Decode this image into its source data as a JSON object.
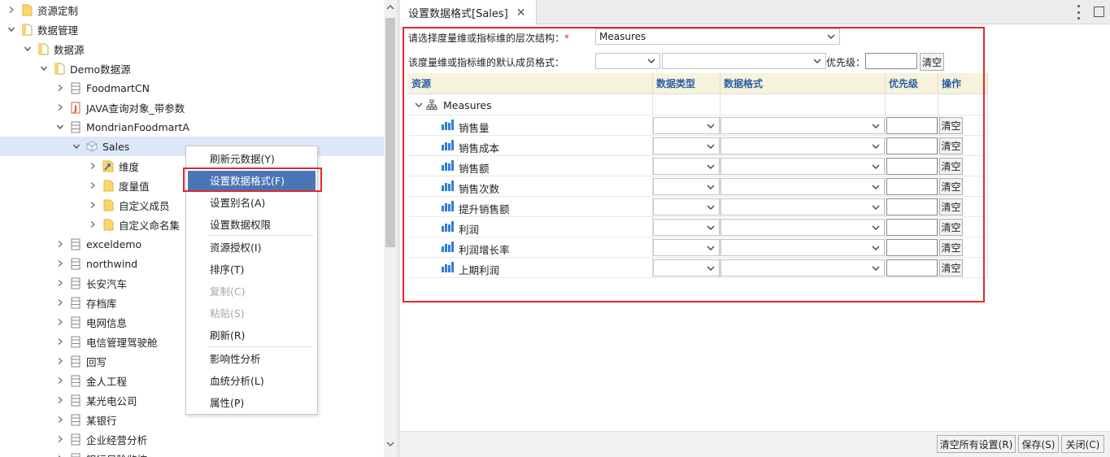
{
  "tree": {
    "items": [
      {
        "label": "资源定制",
        "icon": "folder-icon",
        "expanded": false
      },
      {
        "label": "数据管理",
        "icon": "folder-doc-icon",
        "expanded": true
      },
      {
        "label": "数据源",
        "icon": "folder-doc-icon",
        "expanded": true
      },
      {
        "label": "Demo数据源",
        "icon": "folder-doc-icon",
        "expanded": true
      },
      {
        "label": "FoodmartCN",
        "icon": "database-icon",
        "expanded": false
      },
      {
        "label": "JAVA查询对象_带参数",
        "icon": "java-icon",
        "expanded": false
      },
      {
        "label": "MondrianFoodmartA",
        "icon": "database-icon",
        "expanded": true
      },
      {
        "label": "Sales",
        "icon": "cube-icon",
        "expanded": true
      },
      {
        "label": "维度",
        "icon": "dimension-folder-icon",
        "expanded": false
      },
      {
        "label": "度量值",
        "icon": "folder-icon",
        "expanded": false
      },
      {
        "label": "自定义成员",
        "icon": "folder-icon",
        "expanded": false
      },
      {
        "label": "自定义命名集",
        "icon": "folder-icon",
        "expanded": false
      },
      {
        "label": "exceldemo",
        "icon": "database-icon",
        "expanded": false
      },
      {
        "label": "northwind",
        "icon": "database-icon",
        "expanded": false
      },
      {
        "label": "长安汽车",
        "icon": "database-icon",
        "expanded": false
      },
      {
        "label": "存档库",
        "icon": "database-icon",
        "expanded": false
      },
      {
        "label": "电网信息",
        "icon": "database-icon",
        "expanded": false
      },
      {
        "label": "电信管理驾驶舱",
        "icon": "database-icon",
        "expanded": false
      },
      {
        "label": "回写",
        "icon": "database-icon",
        "expanded": false
      },
      {
        "label": "金人工程",
        "icon": "database-icon",
        "expanded": false
      },
      {
        "label": "某光电公司",
        "icon": "database-icon",
        "expanded": false
      },
      {
        "label": "某银行",
        "icon": "database-icon",
        "expanded": false
      },
      {
        "label": "企业经营分析",
        "icon": "database-icon",
        "expanded": false
      },
      {
        "label": "银行风险监控",
        "icon": "database-icon",
        "expanded": false
      }
    ]
  },
  "context_menu": {
    "items": [
      {
        "label": "刷新元数据(Y)",
        "state": "normal"
      },
      {
        "label": "设置数据格式(F)",
        "state": "highlighted"
      },
      {
        "label": "设置别名(A)",
        "state": "normal"
      },
      {
        "label": "设置数据权限",
        "state": "normal"
      },
      {
        "label": "资源授权(I)",
        "state": "normal"
      },
      {
        "label": "排序(T)",
        "state": "normal"
      },
      {
        "label": "复制(C)",
        "state": "disabled"
      },
      {
        "label": "粘贴(S)",
        "state": "disabled"
      },
      {
        "label": "刷新(R)",
        "state": "normal"
      },
      {
        "label": "影响性分析",
        "state": "normal"
      },
      {
        "label": "血统分析(L)",
        "state": "normal"
      },
      {
        "label": "属性(P)",
        "state": "normal"
      }
    ]
  },
  "tab": {
    "title": "设置数据格式[Sales]",
    "close": "✕"
  },
  "form": {
    "hierarchy_label": "请选择度量维或指标维的层次结构：",
    "required_mark": "*",
    "hierarchy_value": "Measures",
    "default_format_label": "该度量维或指标维的默认成员格式：",
    "default_type_value": "",
    "default_format_value": "",
    "priority_label": "优先级：",
    "priority_value": "",
    "clear_label": "清空"
  },
  "grid": {
    "columns": [
      "资源",
      "数据类型",
      "数据格式",
      "优先级",
      "操作"
    ],
    "root": "Measures",
    "rows": [
      {
        "name": "销售量",
        "type": "",
        "format": "",
        "priority": "",
        "action": "清空"
      },
      {
        "name": "销售成本",
        "type": "",
        "format": "",
        "priority": "",
        "action": "清空"
      },
      {
        "name": "销售额",
        "type": "",
        "format": "",
        "priority": "",
        "action": "清空"
      },
      {
        "name": "销售次数",
        "type": "",
        "format": "",
        "priority": "",
        "action": "清空"
      },
      {
        "name": "提升销售额",
        "type": "",
        "format": "",
        "priority": "",
        "action": "清空"
      },
      {
        "name": "利润",
        "type": "",
        "format": "",
        "priority": "",
        "action": "清空"
      },
      {
        "name": "利润增长率",
        "type": "",
        "format": "",
        "priority": "",
        "action": "清空"
      },
      {
        "name": "上期利润",
        "type": "",
        "format": "",
        "priority": "",
        "action": "清空"
      }
    ]
  },
  "footer": {
    "clear_all": "清空所有设置(R)",
    "save": "保存(S)",
    "close": "关闭(C)"
  },
  "colors": {
    "accent": "#4a76b5",
    "highlight_border": "#e0282d",
    "header_bg": "#f7f2dc",
    "header_text": "#2a5fa8"
  }
}
